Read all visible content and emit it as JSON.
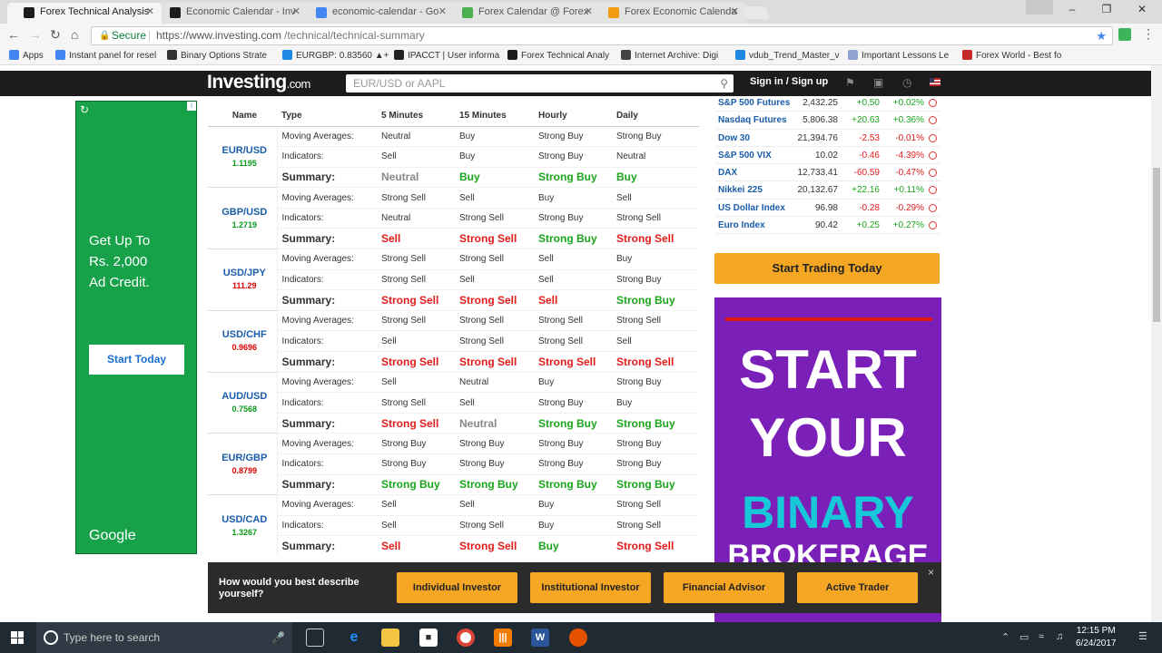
{
  "browser": {
    "tabs": [
      {
        "title": "Forex Technical Analysis",
        "favicon": "investing-icon",
        "color": "#1c1c1c",
        "active": true
      },
      {
        "title": "Economic Calendar - Inv",
        "favicon": "investing-icon",
        "color": "#1c1c1c",
        "active": false
      },
      {
        "title": "economic-calendar - Go",
        "favicon": "google-icon",
        "color": "#4285f4",
        "active": false
      },
      {
        "title": "Forex Calendar @ Forex",
        "favicon": "forexfactory-icon",
        "color": "#4caf50",
        "active": false
      },
      {
        "title": "Forex Economic Calenda",
        "favicon": "dailyfx-icon",
        "color": "#f39c12",
        "active": false
      }
    ],
    "secure_label": "Secure",
    "url_domain": "https://www.investing.com",
    "url_path": "/technical/technical-summary",
    "bookmarks": [
      {
        "label": "Apps",
        "icon": "apps-grid-icon",
        "color": "#4285f4"
      },
      {
        "label": "Instant panel for resel",
        "icon": "google-icon",
        "color": "#4285f4"
      },
      {
        "label": "Binary Options Strate",
        "icon": "bookmark-icon",
        "color": "#333333"
      },
      {
        "label": "EURGBP: 0.83560 ▲+",
        "icon": "cloud-icon",
        "color": "#1e88e5"
      },
      {
        "label": "IPACCT | User informa",
        "icon": "ipacct-icon",
        "color": "#222222"
      },
      {
        "label": "Forex Technical Analy",
        "icon": "investing-icon",
        "color": "#1c1c1c"
      },
      {
        "label": "Internet Archive: Digi",
        "icon": "archive-icon",
        "color": "#444444"
      },
      {
        "label": "vdub_Trend_Master_v",
        "icon": "cloud-icon",
        "color": "#1e88e5"
      },
      {
        "label": "Important Lessons Le",
        "icon": "globe-icon",
        "color": "#90a4d4"
      },
      {
        "label": "Forex World - Best fo",
        "icon": "forexworld-icon",
        "color": "#c62828"
      }
    ]
  },
  "site": {
    "logo_main": "Investing",
    "logo_suffix": ".com",
    "search_placeholder": "EUR/USD or AAPL",
    "sign_in": "Sign in",
    "sep": "/",
    "sign_up": "Sign up"
  },
  "ad_left": {
    "line1": "Get Up To",
    "line2": "Rs. 2,000",
    "line3": "Ad Credit.",
    "button": "Start Today",
    "brand": "Google",
    "bg_color": "#17a24a"
  },
  "summary_table": {
    "headers": [
      "Name",
      "Type",
      "5 Minutes",
      "15 Minutes",
      "Hourly",
      "Daily"
    ],
    "row_labels": [
      "Moving Averages:",
      "Indicators:",
      "Summary:"
    ],
    "pairs": [
      {
        "name": "EUR/USD",
        "price": "1.1195",
        "dir": "up",
        "ma": [
          "Neutral",
          "Buy",
          "Strong Buy",
          "Strong Buy"
        ],
        "ind": [
          "Sell",
          "Buy",
          "Strong Buy",
          "Neutral"
        ],
        "sum": [
          "Neutral",
          "Buy",
          "Strong Buy",
          "Buy"
        ]
      },
      {
        "name": "GBP/USD",
        "price": "1.2719",
        "dir": "up",
        "ma": [
          "Strong Sell",
          "Sell",
          "Buy",
          "Sell"
        ],
        "ind": [
          "Neutral",
          "Strong Sell",
          "Strong Buy",
          "Strong Sell"
        ],
        "sum": [
          "Sell",
          "Strong Sell",
          "Strong Buy",
          "Strong Sell"
        ]
      },
      {
        "name": "USD/JPY",
        "price": "111.29",
        "dir": "dn",
        "ma": [
          "Strong Sell",
          "Strong Sell",
          "Sell",
          "Buy"
        ],
        "ind": [
          "Strong Sell",
          "Sell",
          "Sell",
          "Strong Buy"
        ],
        "sum": [
          "Strong Sell",
          "Strong Sell",
          "Sell",
          "Strong Buy"
        ]
      },
      {
        "name": "USD/CHF",
        "price": "0.9696",
        "dir": "dn",
        "ma": [
          "Strong Sell",
          "Strong Sell",
          "Strong Sell",
          "Strong Sell"
        ],
        "ind": [
          "Sell",
          "Strong Sell",
          "Strong Sell",
          "Sell"
        ],
        "sum": [
          "Strong Sell",
          "Strong Sell",
          "Strong Sell",
          "Strong Sell"
        ]
      },
      {
        "name": "AUD/USD",
        "price": "0.7568",
        "dir": "up",
        "ma": [
          "Sell",
          "Neutral",
          "Buy",
          "Strong Buy"
        ],
        "ind": [
          "Strong Sell",
          "Sell",
          "Strong Buy",
          "Buy"
        ],
        "sum": [
          "Strong Sell",
          "Neutral",
          "Strong Buy",
          "Strong Buy"
        ]
      },
      {
        "name": "EUR/GBP",
        "price": "0.8799",
        "dir": "dn",
        "ma": [
          "Strong Buy",
          "Strong Buy",
          "Strong Buy",
          "Strong Buy"
        ],
        "ind": [
          "Strong Buy",
          "Strong Buy",
          "Strong Buy",
          "Strong Buy"
        ],
        "sum": [
          "Strong Buy",
          "Strong Buy",
          "Strong Buy",
          "Strong Buy"
        ]
      },
      {
        "name": "USD/CAD",
        "price": "1.3267",
        "dir": "up",
        "ma": [
          "Sell",
          "Sell",
          "Buy",
          "Strong Sell"
        ],
        "ind": [
          "Sell",
          "Strong Sell",
          "Buy",
          "Strong Sell"
        ],
        "sum": [
          "Sell",
          "Strong Sell",
          "Buy",
          "Strong Sell"
        ]
      }
    ]
  },
  "indices": [
    {
      "name": "S&P 500 Futures",
      "value": "2,432.25",
      "change": "+0.50",
      "pct": "+0.02%",
      "dir": "pos"
    },
    {
      "name": "Nasdaq Futures",
      "value": "5,806.38",
      "change": "+20.63",
      "pct": "+0.36%",
      "dir": "pos"
    },
    {
      "name": "Dow 30",
      "value": "21,394.76",
      "change": "-2.53",
      "pct": "-0.01%",
      "dir": "neg"
    },
    {
      "name": "S&P 500 VIX",
      "value": "10.02",
      "change": "-0.46",
      "pct": "-4.39%",
      "dir": "neg"
    },
    {
      "name": "DAX",
      "value": "12,733.41",
      "change": "-60.59",
      "pct": "-0.47%",
      "dir": "neg"
    },
    {
      "name": "Nikkei 225",
      "value": "20,132.67",
      "change": "+22.16",
      "pct": "+0.11%",
      "dir": "pos"
    },
    {
      "name": "US Dollar Index",
      "value": "96.98",
      "change": "-0.28",
      "pct": "-0.29%",
      "dir": "neg"
    },
    {
      "name": "Euro Index",
      "value": "90.42",
      "change": "+0.25",
      "pct": "+0.27%",
      "dir": "pos"
    }
  ],
  "start_trading": "Start Trading Today",
  "binary_ad": {
    "line1": "START",
    "line2": "YOUR",
    "line3": "BINARY",
    "line4": "BROKERAGE",
    "accent_color": "#17c9d8",
    "bg_color": "#7a1fb8"
  },
  "survey": {
    "question": "How would you best describe yourself?",
    "options": [
      "Individual Investor",
      "Institutional Investor",
      "Financial Advisor",
      "Active Trader"
    ],
    "close": "×"
  },
  "taskbar": {
    "search_placeholder": "Type here to search",
    "time": "12:15 PM",
    "date": "6/24/2017"
  },
  "colors": {
    "buy": "#1aa51a",
    "sell": "#e21b1b",
    "neutral": "#888888",
    "accent": "#f5a623"
  }
}
